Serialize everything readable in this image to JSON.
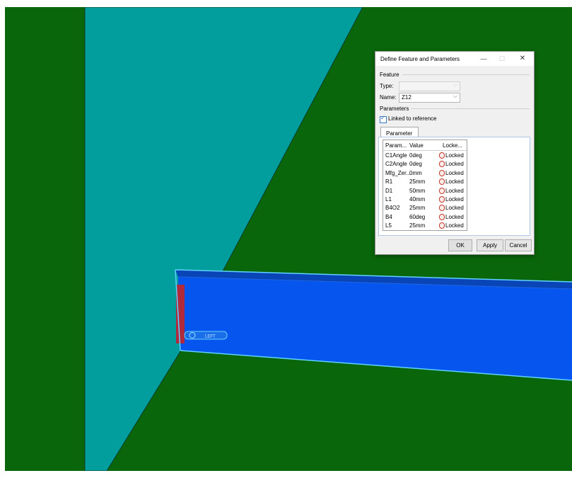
{
  "colors": {
    "background": "#0a660a",
    "plane": "#029e9e",
    "beam": "#0555ee",
    "beam_top": "#0a45b8",
    "beam_edge": "#b02a3c",
    "beam_outline": "#5fd1ff"
  },
  "viewport": {
    "label": "LEFT",
    "label_icon": "circle-arrow-icon"
  },
  "dialog": {
    "title": "Define Feature and Parameters",
    "controls": {
      "minimize": "—",
      "maximize": "☐",
      "close": "✕"
    },
    "feature_group": "Feature",
    "type_label": "Type:",
    "type_value": "",
    "name_label": "Name:",
    "name_value": "Z12",
    "parameters_group": "Parameters",
    "linked_checkbox_label": "Linked to reference",
    "linked_checked": true,
    "tab_label": "Parameter",
    "table": {
      "headers": [
        "Param...",
        "Value",
        "Locke..."
      ],
      "rows": [
        {
          "param": "C1Angle",
          "value": "0deg",
          "locked": "Locked"
        },
        {
          "param": "C2Angle",
          "value": "0deg",
          "locked": "Locked"
        },
        {
          "param": "Mfg_Zer...",
          "value": "0mm",
          "locked": "Locked"
        },
        {
          "param": "R1",
          "value": "25mm",
          "locked": "Locked"
        },
        {
          "param": "D1",
          "value": "50mm",
          "locked": "Locked"
        },
        {
          "param": "L1",
          "value": "40mm",
          "locked": "Locked"
        },
        {
          "param": "B4O2",
          "value": "25mm",
          "locked": "Locked"
        },
        {
          "param": "B4",
          "value": "60deg",
          "locked": "Locked"
        },
        {
          "param": "L5",
          "value": "25mm",
          "locked": "Locked"
        }
      ]
    },
    "buttons": {
      "ok": "OK",
      "apply": "Apply",
      "cancel": "Cancel"
    }
  }
}
